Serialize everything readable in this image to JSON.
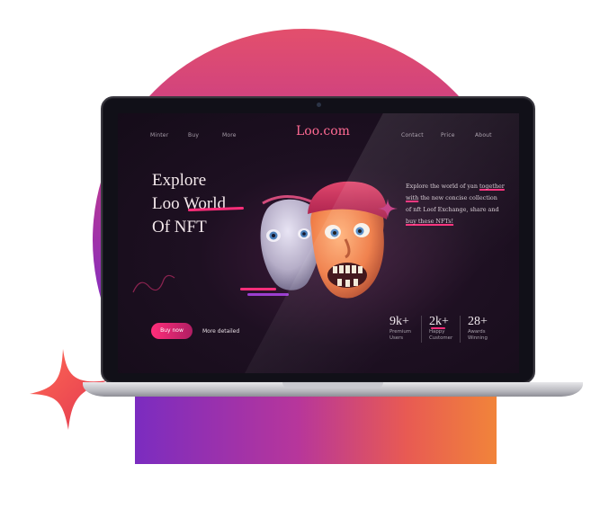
{
  "nav": {
    "left": [
      "Minter",
      "Buy",
      "More"
    ],
    "logo": "Loo.com",
    "right": [
      "Contact",
      "Price",
      "About"
    ]
  },
  "hero": {
    "headline_lines": [
      "Explore",
      "Loo World",
      "Of NFT"
    ],
    "description": {
      "part1": "Explore the world of yan ",
      "hl1": "together with",
      "part2": " the new concise collection of nft Loof Exchange, share and ",
      "hl2": "buy these NFTs!"
    }
  },
  "actions": {
    "buy_label": "Buy now",
    "more_label": "More detailed"
  },
  "stats": [
    {
      "value": "9k+",
      "label1": "Premium",
      "label2": "Users"
    },
    {
      "value": "2k+",
      "label1": "Happy",
      "label2": "Customer"
    },
    {
      "value": "28+",
      "label1": "Awards",
      "label2": "Winning"
    }
  ],
  "colors": {
    "accent": "#ff2e7a",
    "logo": "#ff6a93",
    "screen_bg": "#1e1022"
  }
}
